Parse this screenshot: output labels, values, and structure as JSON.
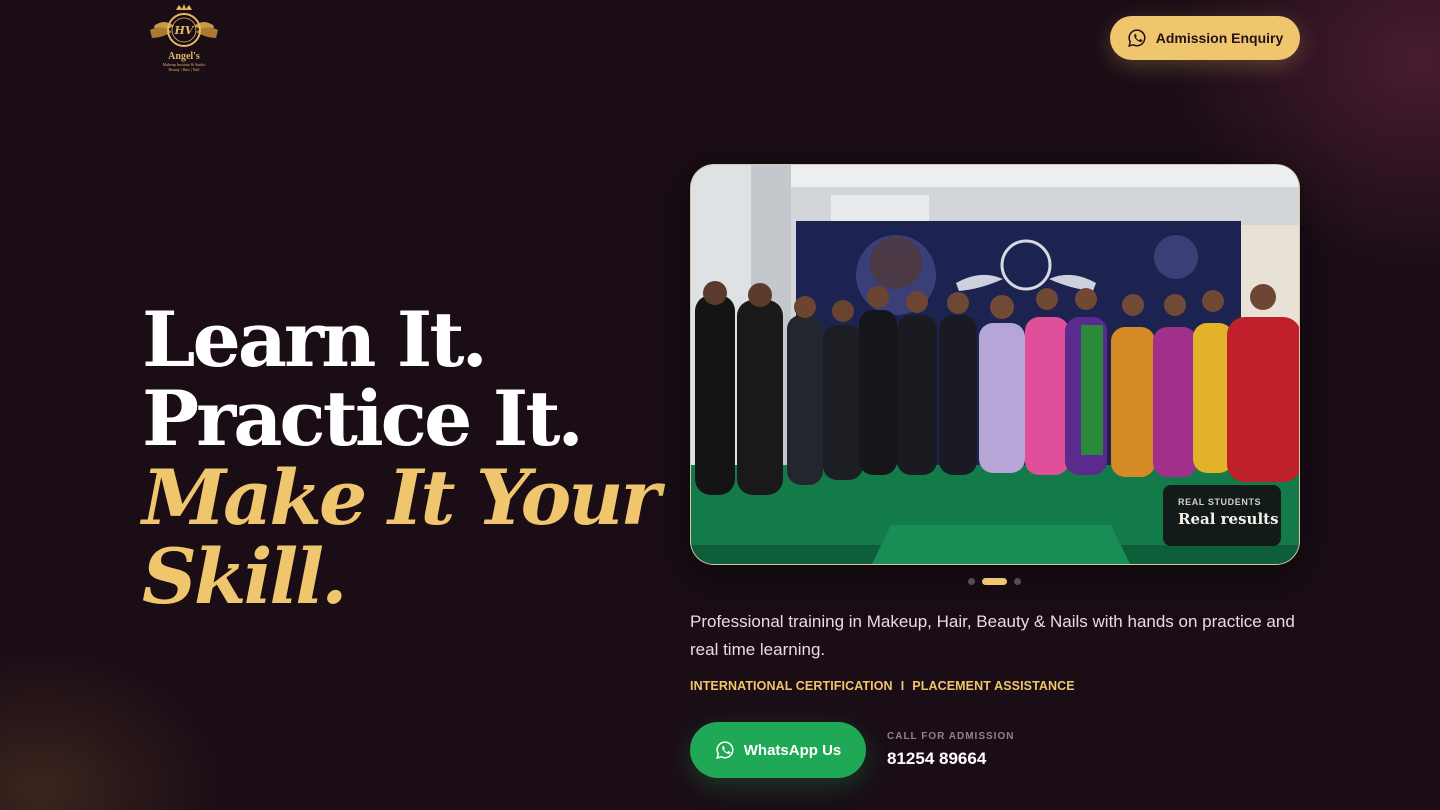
{
  "brand": {
    "monogram": "HV",
    "name": "Angel's",
    "tagline": "Makeup Institute & Studio",
    "services_line": "Beauty | Hair | Nail"
  },
  "header": {
    "enquiry_label": "Admission Enquiry",
    "enquiry_icon": "whatsapp-icon"
  },
  "hero": {
    "line1": "Learn It.",
    "line2": "Practice It.",
    "line3": "Make It Your",
    "line4": "Skill."
  },
  "carousel": {
    "badge_label": "REAL STUDENTS",
    "badge_title": "Real results",
    "slide_count": 3,
    "active_slide": 2
  },
  "description": "Professional training in Makeup, Hair, Beauty & Nails with hands on practice and real time learning.",
  "highlights": {
    "item1": "INTERNATIONAL CERTIFICATION",
    "separator": "I",
    "item2": "PLACEMENT ASSISTANCE"
  },
  "cta": {
    "whatsapp_label": "WhatsApp Us",
    "call_label": "CALL FOR ADMISSION",
    "call_number": "81254 89664"
  },
  "colors": {
    "background": "#1a0d16",
    "gold": "#efc66d",
    "whatsapp_green": "#1fa855"
  }
}
